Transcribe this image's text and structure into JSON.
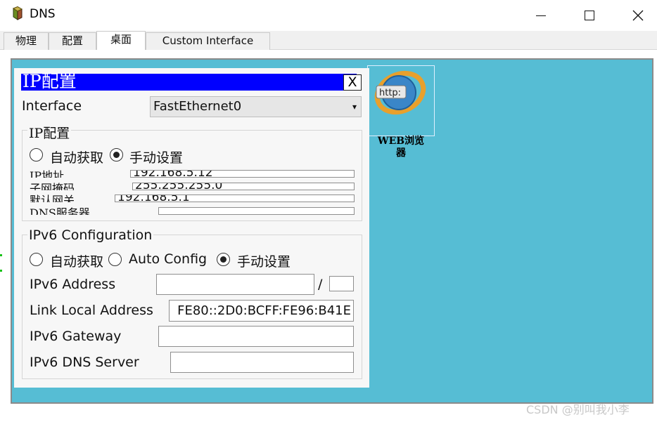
{
  "window": {
    "title": "DNS",
    "icon": "network-device-icon"
  },
  "tabs": [
    {
      "label": "物理"
    },
    {
      "label": "配置"
    },
    {
      "label": "桌面"
    },
    {
      "label": "Custom Interface"
    }
  ],
  "desktop": {
    "background": "#56bdd4",
    "web_browser": {
      "icon": "web-browser-icon",
      "icon_text": "http:",
      "label_line1": "WEB浏览",
      "label_line2": "器"
    }
  },
  "dialog": {
    "title": "IP配置",
    "close_label": "X",
    "interface_label": "Interface",
    "interface_value": "FastEthernet0",
    "ipv4": {
      "group_title": "IP配置",
      "dhcp_label": "自动获取",
      "static_label": "手动设置",
      "selected": "static",
      "ip_label": "IP地址",
      "ip_value": "192.168.5.12",
      "mask_label": "子网掩码",
      "mask_value": "255.255.255.0",
      "gateway_label": "默认网关",
      "gateway_value": "192.168.5.1",
      "dns_label": "DNS服务器",
      "dns_value": ""
    },
    "ipv6": {
      "group_title": "IPv6 Configuration",
      "dhcp_label": "自动获取",
      "auto_config_label": "Auto Config",
      "static_label": "手动设置",
      "selected": "static",
      "address_label": "IPv6 Address",
      "address_value": "",
      "prefix_separator": "/",
      "prefix_value": "",
      "link_local_label": "Link Local Address",
      "link_local_value": "FE80::2D0:BCFF:FE96:B41E",
      "gateway_label": "IPv6 Gateway",
      "gateway_value": "",
      "dns_label": "IPv6 DNS Server",
      "dns_value": ""
    }
  },
  "watermark": "CSDN @别叫我小李",
  "colors": {
    "dialog_title_bg": "#0000ff",
    "desktop_bg": "#56bdd4"
  }
}
